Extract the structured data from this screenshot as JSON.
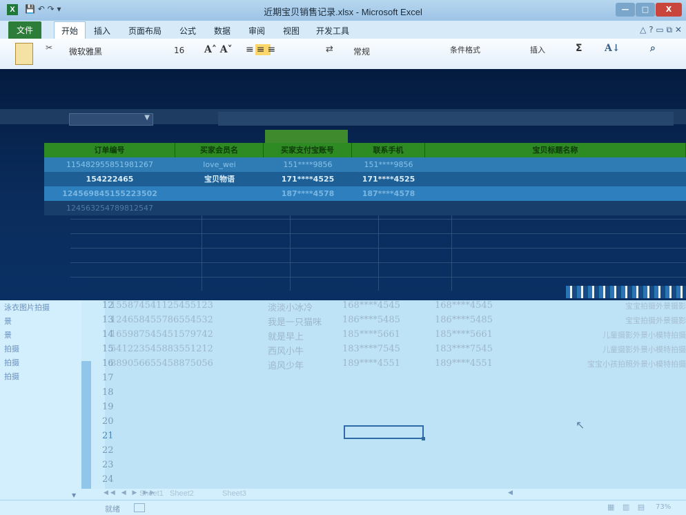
{
  "window": {
    "title": "近期宝贝销售记录.xlsx - Microsoft Excel",
    "app_icon": "excel-icon",
    "controls": {
      "minimize": "—",
      "maximize": "□",
      "close": "X"
    }
  },
  "ribbon": {
    "tabs": [
      "文件",
      "开始",
      "插入",
      "页面布局",
      "公式",
      "数据",
      "审阅",
      "视图",
      "开发工具"
    ],
    "active_tab": "开始",
    "font_name": "微软雅黑",
    "font_size": "16",
    "number_format": "常规",
    "conditional_format_label": "条件格式",
    "insert_label": "插入",
    "sum_symbol": "Σ"
  },
  "header_table": {
    "columns": [
      "订单编号",
      "买家会员名",
      "买家支付宝账号",
      "联系手机",
      "宝贝标题名称"
    ],
    "rows": [
      [
        "115482955851981267",
        "love_wei",
        "151****9856",
        "151****9856",
        ""
      ],
      [
        "154222465",
        "宝贝物语",
        "171****4525",
        "171****4525",
        ""
      ],
      [
        "124569845155223502",
        "",
        "187****4578",
        "187****4578",
        ""
      ],
      [
        "124563254789812547",
        "",
        "",
        "",
        ""
      ]
    ]
  },
  "sidebar": {
    "items": [
      "泳衣图片拍摄",
      "景",
      "拍摄",
      "拍摄",
      "拍摄"
    ]
  },
  "sheet": {
    "row_numbers": [
      "12",
      "13",
      "14",
      "15",
      "16",
      "17",
      "18",
      "19",
      "20",
      "21",
      "22",
      "23",
      "24"
    ],
    "active_row": "21",
    "rows": [
      {
        "id": "155874541125455123",
        "nick": "淡淡小冰冷",
        "phone1": "168****4545",
        "phone2": "168****4545",
        "title": "宝宝拍摄外景摄影"
      },
      {
        "id": "124658455786554532",
        "nick": "我是一只猫咪",
        "phone1": "186****5485",
        "phone2": "186****5485",
        "title": "宝宝拍摄外景摄影"
      },
      {
        "id": "165987545451579742",
        "nick": "就是早上",
        "phone1": "185****5661",
        "phone2": "185****5661",
        "title": "儿童摄影外景小模特拍摄"
      },
      {
        "id": "541223545883551212",
        "nick": "西风小牛",
        "phone1": "183****7545",
        "phone2": "183****7545",
        "title": "儿童摄影外景小模特拍摄"
      },
      {
        "id": "889056655458875056",
        "nick": "追风少年",
        "phone1": "189****4551",
        "phone2": "189****4551",
        "title": "宝宝小孩拍照外景小模特拍摄"
      }
    ],
    "tabs": [
      "Sheet1",
      "Sheet2",
      "Sheet3"
    ]
  },
  "status": {
    "ready_label": "就绪",
    "zoom": "73%"
  }
}
